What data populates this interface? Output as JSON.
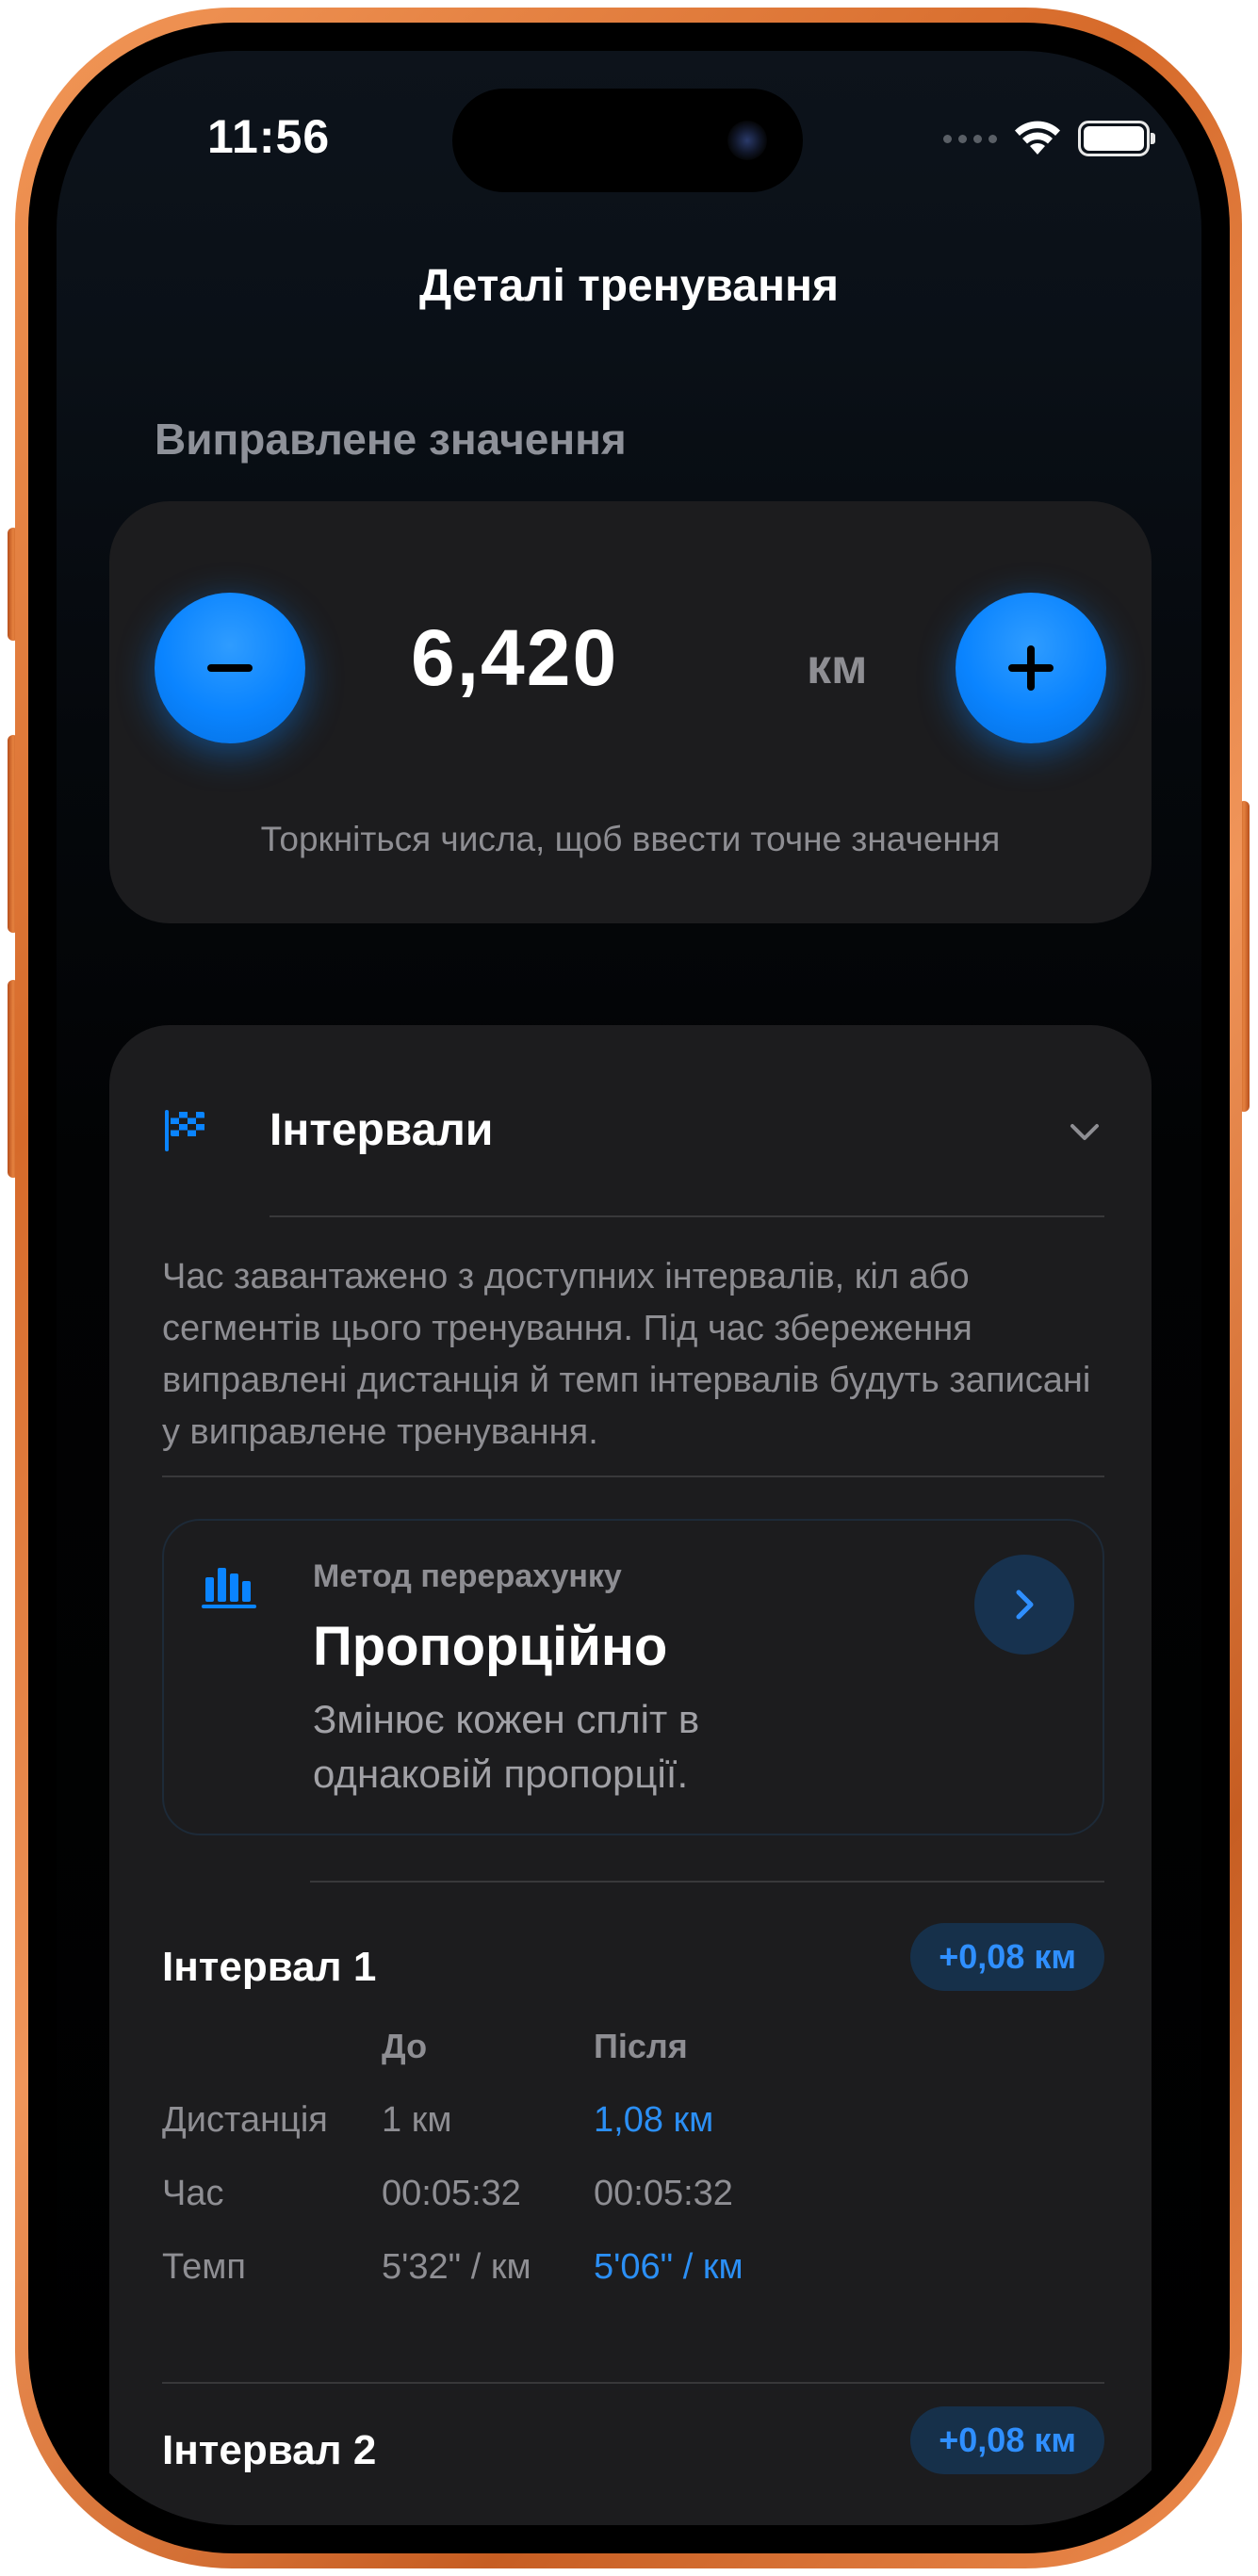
{
  "status_bar": {
    "time": "11:56"
  },
  "nav": {
    "title": "Деталі тренування"
  },
  "corrected_value": {
    "caption": "Виправлене значення",
    "value": "6,420",
    "unit": "км",
    "hint": "Торкніться числа, щоб ввести точне значення"
  },
  "intervals_section": {
    "title": "Інтервали",
    "description": "Час завантажено з доступних інтервалів, кіл або сегментів цього тренування. Під час збереження виправлені дистанція й темп інтервалів будуть записані у виправлене тренування.",
    "method": {
      "label": "Метод перерахунку",
      "value": "Пропорційно",
      "description": "Змінює кожен спліт в однаковій пропорції."
    },
    "column_headers": {
      "before": "До",
      "after": "Після"
    },
    "row_labels": {
      "distance": "Дистанція",
      "time": "Час",
      "pace": "Темп"
    },
    "intervals": [
      {
        "name": "Інтервал 1",
        "delta": "+0,08 км",
        "distance_before": "1 км",
        "distance_after": "1,08 км",
        "time_before": "00:05:32",
        "time_after": "00:05:32",
        "pace_before": "5'32\" / км",
        "pace_after": "5'06\" / км"
      },
      {
        "name": "Інтервал 2",
        "delta": "+0,08 км"
      }
    ]
  },
  "colors": {
    "accent": "#0a84ff",
    "card_background": "#1c1c1e",
    "frame": "#e07a3a"
  }
}
